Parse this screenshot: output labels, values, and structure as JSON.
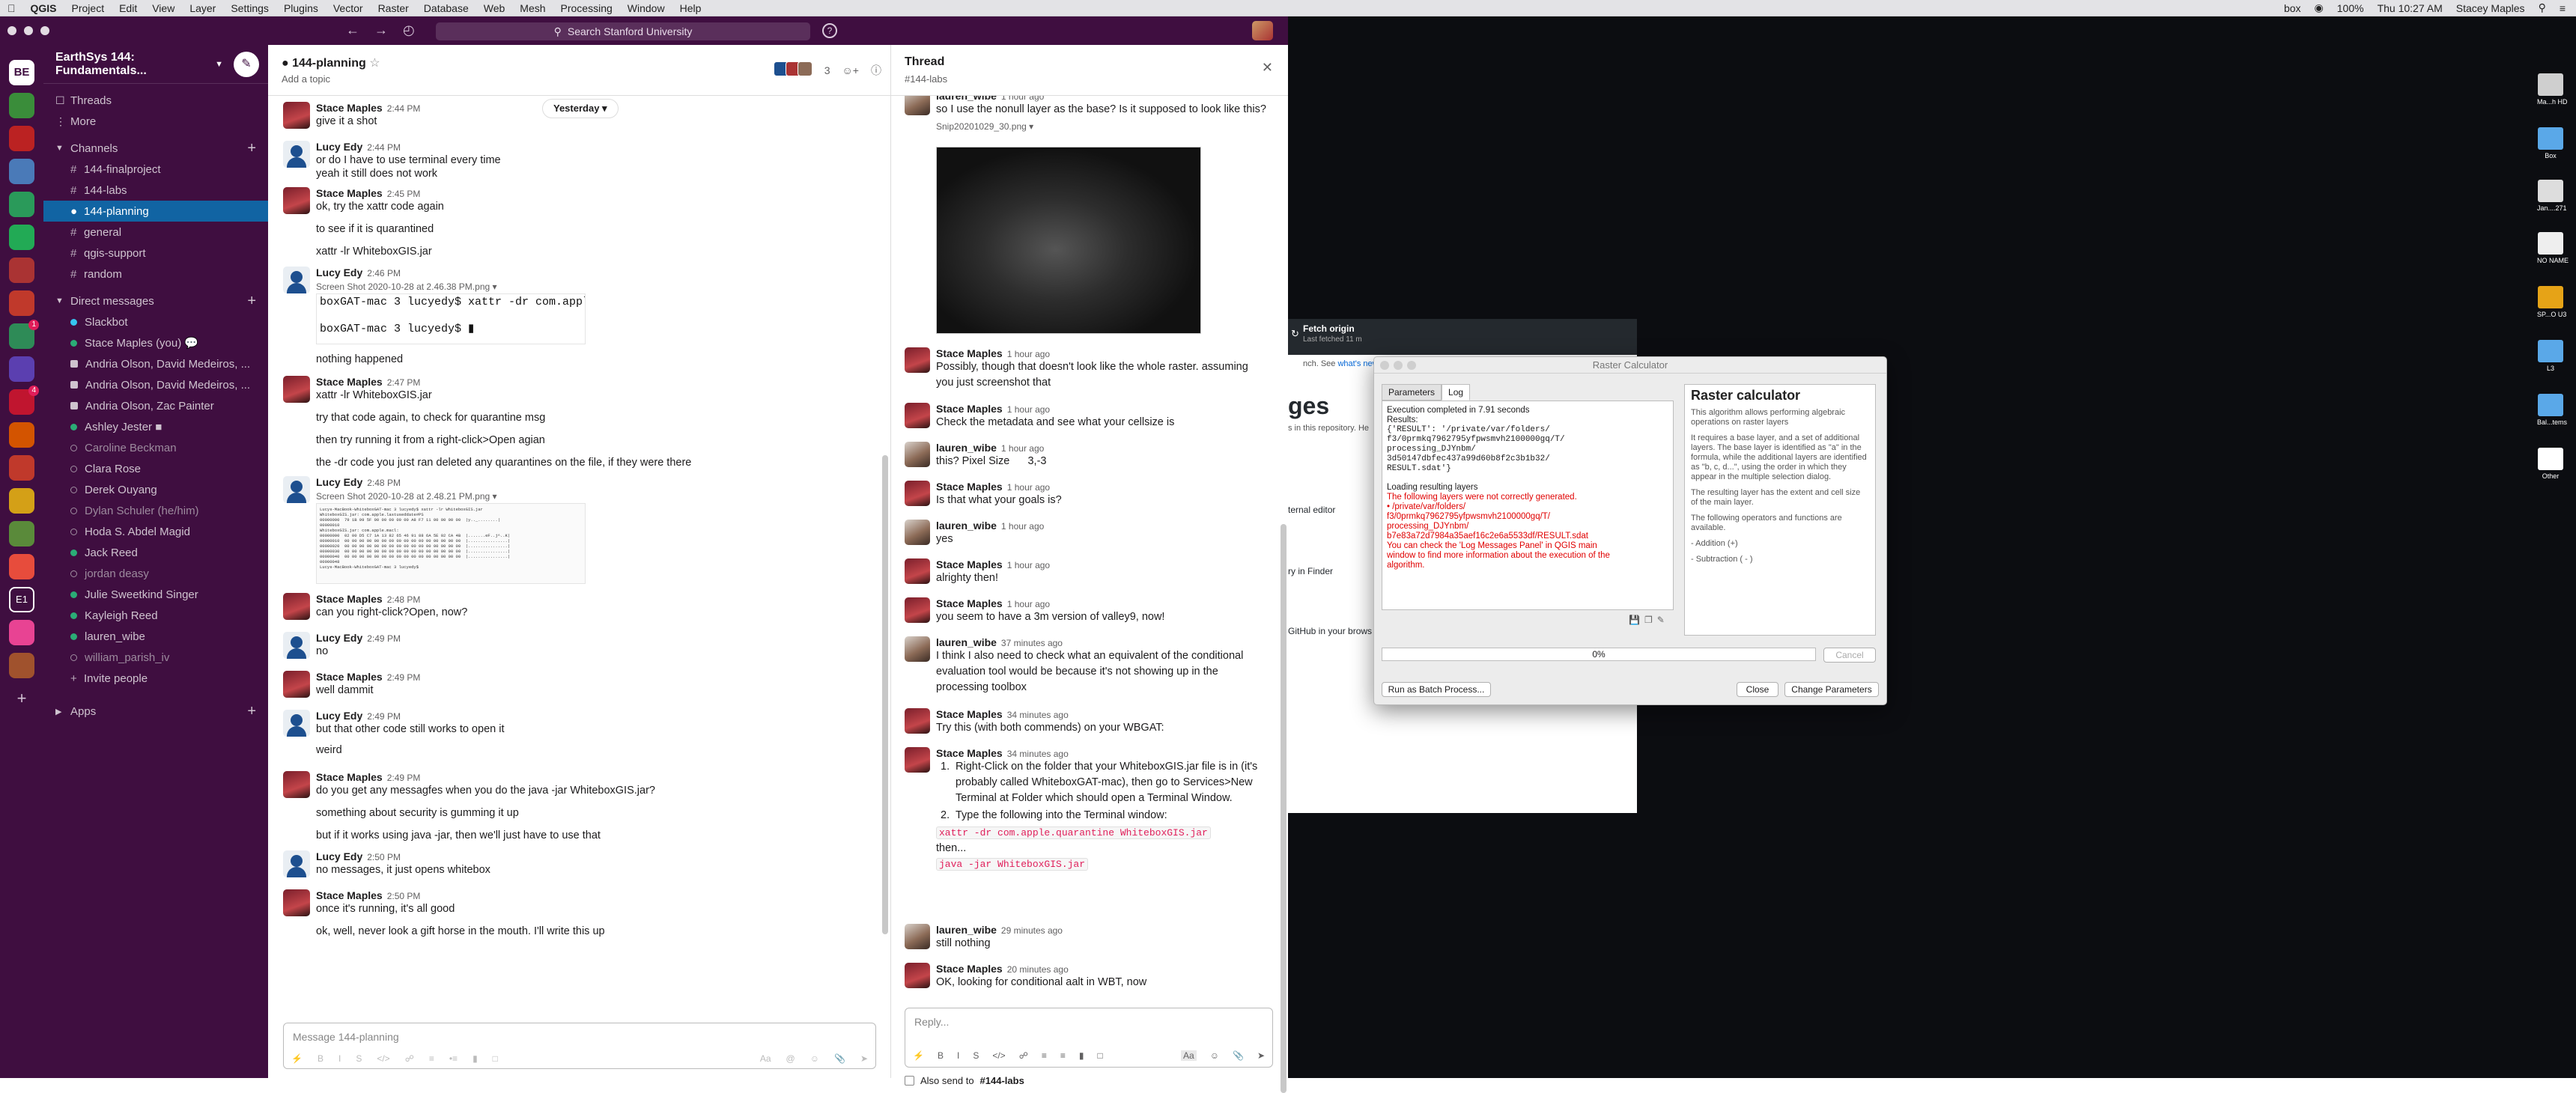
{
  "menubar": {
    "app": "QGIS",
    "items": [
      "Project",
      "Edit",
      "View",
      "Layer",
      "Settings",
      "Plugins",
      "Vector",
      "Raster",
      "Database",
      "Web",
      "Mesh",
      "Processing",
      "Window",
      "Help"
    ],
    "battery": "100%",
    "clock": "Thu 10:27 AM",
    "user": "Stacey Maples",
    "box": "box"
  },
  "slack": {
    "search_placeholder": "Search Stanford University",
    "workspace_initials": "BE",
    "workspace_name": "EarthSys 144: Fundamentals...",
    "e1_label": "E1",
    "rail_badges": {
      "b1": "1",
      "b2": "4"
    },
    "sidebar": {
      "threads": "Threads",
      "more": "More",
      "channels_label": "Channels",
      "channels": [
        "144-finalproject",
        "144-labs",
        "144-planning",
        "general",
        "qgis-support",
        "random"
      ],
      "dms_label": "Direct messages",
      "dms": [
        "Slackbot",
        "Stace Maples",
        "Andria Olson, David Medeiros, ...",
        "Andria Olson, David Medeiros, ...",
        "Andria Olson, Zac Painter",
        "Ashley Jester",
        "Caroline Beckman",
        "Clara Rose",
        "Derek Ouyang",
        "Dylan Schuler (he/him)",
        "Hoda S. Abdel Magid",
        "Jack Reed",
        "jordan deasy",
        "Julie Sweetkind Singer",
        "Kayleigh Reed",
        "lauren_wibe",
        "william_parish_iv"
      ],
      "you": "(you)",
      "invite": "Invite people",
      "apps_label": "Apps"
    },
    "channel": {
      "name": "144-planning",
      "topic": "Add a topic",
      "member_count": "3",
      "date_pill": "Yesterday",
      "input_placeholder": "Message 144-planning"
    },
    "messages": [
      {
        "name": "Stace Maples",
        "time": "2:44 PM",
        "text": "give it a shot"
      },
      {
        "name": "Lucy Edy",
        "time": "2:44 PM",
        "text": "or do I have to use terminal every time"
      },
      {
        "text": "yeah it still does not work"
      },
      {
        "name": "Stace Maples",
        "time": "2:45 PM",
        "text": "ok, try the xattr code again"
      },
      {
        "text": "to see if it is quarantined"
      },
      {
        "text": "xattr -lr WhiteboxGIS.jar"
      },
      {
        "name": "Lucy Edy",
        "time": "2:46 PM",
        "file": "Screen Shot 2020-10-28 at 2.46.38 PM.png"
      },
      {
        "text": "nothing happened"
      },
      {
        "name": "Stace Maples",
        "time": "2:47 PM",
        "text": "xattr -lr WhiteboxGIS.jar"
      },
      {
        "text": "try that code again, to check for quarantine msg"
      },
      {
        "text": "then try running it from a right-click>Open agian"
      },
      {
        "text": "the -dr code you just ran deleted any quarantines on the file, if they were there"
      },
      {
        "name": "Lucy Edy",
        "time": "2:48 PM",
        "file": "Screen Shot 2020-10-28 at 2.48.21 PM.png"
      },
      {
        "name": "Stace Maples",
        "time": "2:48 PM",
        "text": "can you right-click?Open, now?"
      },
      {
        "name": "Lucy Edy",
        "time": "2:49 PM",
        "text": "no"
      },
      {
        "name": "Stace Maples",
        "time": "2:49 PM",
        "text": "well dammit"
      },
      {
        "name": "Lucy Edy",
        "time": "2:49 PM",
        "text": "but that other code still works to open it"
      },
      {
        "text": "weird"
      },
      {
        "name": "Stace Maples",
        "time": "2:49 PM",
        "text": "do you get any messagfes when you do the java -jar WhiteboxGIS.jar?"
      },
      {
        "text": "something about security is gumming it up"
      },
      {
        "text": "but if it works using java -jar, then we'll just have to use that"
      },
      {
        "name": "Lucy Edy",
        "time": "2:50 PM",
        "text": "no messages, it just opens whitebox"
      },
      {
        "name": "Stace Maples",
        "time": "2:50 PM",
        "text": "once it's running, it's all good"
      },
      {
        "text": "ok, well, never look a gift horse in the mouth. I'll write this up"
      }
    ],
    "term1": [
      "boxGAT-mac 3 lucyedy$ xattr -dr com.apple",
      "boxGAT-mac 3 lucyedy$ "
    ],
    "term2": "Lucys-MacBook-WhiteboxGAT-mac 3 lucyedy$ xattr -lr WhiteboxGIS.jar\nWhiteboxGIS.jar: com.apple.lastuseddate#PS\n00000000  79 1B 99 5F 00 00 00 00 00 A8 F7 11 00 00 00 00  |y.._........|\n00000010\nWhiteboxGIS.jar: com.apple.macl:\n00000000  02 00 D5 C7 1A 13 82 65 46 91 88 6A 5E 02 CA 4B  |.......eF..j^..K|\n00000010  00 00 00 00 00 00 00 00 00 00 00 00 00 00 00 00  |................|\n00000020  00 00 00 00 00 00 00 00 00 00 00 00 00 00 00 00  |................|\n00000030  00 00 00 00 00 00 00 00 00 00 00 00 00 00 00 00  |................|\n00000040  00 00 00 00 00 00 00 00 00 00 00 00 00 00 00 00  |................|\n00000048\nLucys-MacBook-WhiteboxGAT-mac 3 lucyedy$ ",
    "thread": {
      "title": "Thread",
      "channel": "#144-labs",
      "top_name": "lauren_wibe",
      "top_time": "1 hour ago",
      "top_text": "so I use the nonull layer as the base? Is it supposed to look like this?",
      "top_file": "Snip20201029_30.png",
      "msgs": [
        {
          "name": "Stace Maples",
          "time": "1 hour ago",
          "lines": [
            "Possibly, though that doesn't look like the whole raster. assuming",
            "you just screenshot that"
          ]
        },
        {
          "name": "Stace Maples",
          "time": "1 hour ago",
          "lines": [
            "Check the metadata and see what your cellsize is"
          ]
        },
        {
          "name": "lauren_wibe",
          "time": "1 hour ago",
          "lines": [
            "this? Pixel Size      3,-3"
          ]
        },
        {
          "name": "Stace Maples",
          "time": "1 hour ago",
          "lines": [
            "Is that what your goals is?"
          ]
        },
        {
          "name": "lauren_wibe",
          "time": "1 hour ago",
          "lines": [
            "yes"
          ]
        },
        {
          "name": "Stace Maples",
          "time": "1 hour ago",
          "lines": [
            "alrighty then!"
          ]
        },
        {
          "name": "Stace Maples",
          "time": "1 hour ago",
          "lines": [
            "you seem to have a 3m version of valley9, now!"
          ]
        },
        {
          "name": "lauren_wibe",
          "time": "37 minutes ago",
          "lines": [
            "I think I also need to check what an equivalent of the conditional",
            "evaluation tool would be because it's not showing up in the",
            "processing toolbox"
          ]
        },
        {
          "name": "Stace Maples",
          "time": "34 minutes ago",
          "lines": [
            "Try this (with both commends) on your WBGAT:"
          ]
        },
        {
          "name": "Stace Maples",
          "time": "34 minutes ago"
        },
        {
          "name": "lauren_wibe",
          "time": "29 minutes ago",
          "lines": [
            "still nothing"
          ]
        },
        {
          "name": "Stace Maples",
          "time": "20 minutes ago",
          "lines": [
            "OK, looking for conditional aalt in WBT, now"
          ]
        }
      ],
      "list_item1": [
        "Right-Click on the folder that your WhiteboxGIS.jar file is in (it's",
        "probably called WhiteboxGAT-mac), then go to Services>New",
        "Terminal at Folder which should open a Terminal Window."
      ],
      "list_item2": "Type the following into the Terminal window:",
      "code1": "xattr -dr com.apple.quarantine WhiteboxGIS.jar",
      "then": "then...",
      "code2": "java -jar WhiteboxGIS.jar",
      "reply_placeholder": "Reply...",
      "also_send": "Also send to",
      "also_send_channel": "#144-labs"
    }
  },
  "github": {
    "fetch_title": "Fetch origin",
    "fetch_sub": "Last fetched 11 m",
    "line1_a": "nch. See ",
    "line1_link": "what's new o",
    "big": "ges",
    "sub1": "s in this repository. He",
    "editor": "ternal editor",
    "finder": "ry in Finder",
    "browser": "GitHub in your brows"
  },
  "raster_calc": {
    "title": "Raster Calculator",
    "tabs": [
      "Parameters",
      "Log"
    ],
    "log_black": [
      "Execution completed in 7.91 seconds",
      "Results:"
    ],
    "log_result": "{'RESULT': '/private/var/folders/\nf3/0prmkq7962795yfpwsmvh2100000gq/T/\nprocessing_DJYnbm/\n3d50147dbfec437a99d60b8f2c3b1b32/\nRESULT.sdat'}",
    "log_loading": "Loading resulting layers",
    "log_red": "The following layers were not correctly generated.\n• /private/var/folders/\nf3/0prmkq7962795yfpwsmvh2100000gq/T/\nprocessing_DJYnbm/\nb7e83a72d7984a35aef16c2e6a5533df/RESULT.sdat\nYou can check the 'Log Messages Panel' in QGIS main\nwindow to find more information about the execution of the\nalgorithm.",
    "help_title": "Raster calculator",
    "help_p1": "This algorithm allows performing algebraic operations on raster layers",
    "help_p2": "It requires a base layer, and a set of additional layers. The base layer is identified as \"a\" in the formula, while the additional layers are identified as \"b, c, d...\", using the order in which they appear in the multiple selection dialog.",
    "help_p3": "The resulting layer has the extent and cell size of the main layer.",
    "help_p4": "The following operators and functions are available.",
    "help_p5": "- Addition (+)",
    "help_p6": "- Subtraction ( - )",
    "progress": "0%",
    "cancel": "Cancel",
    "batch": "Run as Batch Process...",
    "close": "Close",
    "change": "Change Parameters"
  },
  "dock": [
    "Ma...h HD",
    "Box",
    "Jan....271",
    "NO NAME",
    "SP...O U3",
    "L3",
    "Bal...tems",
    "Other"
  ]
}
